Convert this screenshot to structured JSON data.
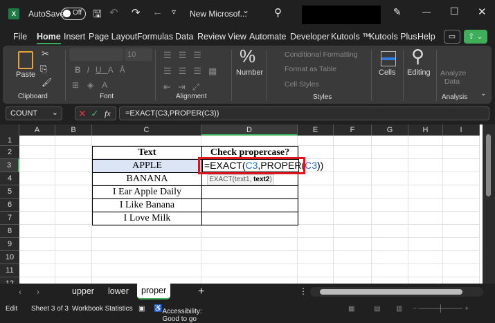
{
  "titlebar": {
    "autosave": "AutoSave",
    "toggle": "Off",
    "doc_title": "New Microsof...",
    "chevron": "⌄"
  },
  "tabs": [
    "File",
    "Home",
    "Insert",
    "Page Layout",
    "Formulas",
    "Data",
    "Review",
    "View",
    "Automate",
    "Developer",
    "Kutools ™",
    "Kutools Plus",
    "Help"
  ],
  "active_tab": "Home",
  "ribbon": {
    "paste": "Paste",
    "clipboard": "Clipboard",
    "font": "Font",
    "font_size": "10",
    "alignment": "Alignment",
    "number": "Number",
    "cond_format": "Conditional Formatting",
    "format_table": "Format as Table",
    "cell_styles": "Cell Styles",
    "styles": "Styles",
    "cells": "Cells",
    "editing": "Editing",
    "analyze": "Analyze Data",
    "analysis": "Analysis"
  },
  "formula_bar": {
    "name_box": "COUNT",
    "formula": "=EXACT(C3,PROPER(C3))",
    "fx": "fx"
  },
  "columns": [
    "A",
    "B",
    "C",
    "D",
    "E",
    "F",
    "G",
    "H",
    "I"
  ],
  "rows": [
    "1",
    "2",
    "3",
    "4",
    "5",
    "6",
    "7",
    "8",
    "9",
    "10",
    "11",
    "12"
  ],
  "table": {
    "header_text": "Text",
    "header_check": "Check propercase?",
    "values": [
      "APPLE",
      "BANANA",
      "I Ear Apple Daily",
      "I Like Banana",
      "I Love Milk"
    ]
  },
  "edit": {
    "formula_parts": [
      "=EXACT(",
      "C3",
      ",PROPER(",
      "C3",
      "))"
    ],
    "tooltip_fn": "EXACT(text1, ",
    "tooltip_arg": "text2",
    ")": ")",
    "tooltip_close": ")"
  },
  "sheets": {
    "tabs": [
      "upper",
      "lower",
      "proper"
    ],
    "active": "proper",
    "add": "+"
  },
  "status": {
    "mode": "Edit",
    "sheet": "Sheet 3 of 3",
    "stats": "Workbook Statistics",
    "accessibility": "Accessibility: Good to go"
  },
  "colors": {
    "accent": "#3fae5a",
    "highlight": "#dbe5f5",
    "ref_blue": "#1f6fd6",
    "ref_red": "#d0202a",
    "callout": "#e0141e"
  }
}
